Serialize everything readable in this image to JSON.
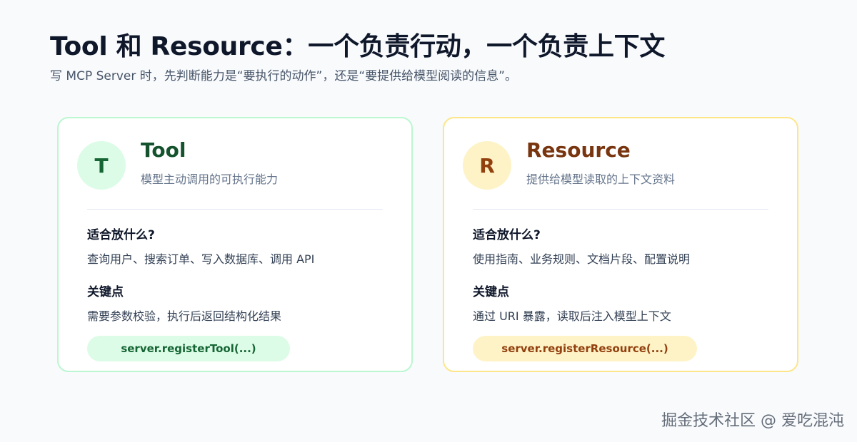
{
  "header": {
    "title": "Tool 和 Resource：一个负责行动，一个负责上下文",
    "subtitle": "写 MCP Server 时，先判断能力是“要执行的动作”，还是“要提供给模型阅读的信息”。"
  },
  "cards": [
    {
      "badge": "T",
      "title": "Tool",
      "description": "模型主动调用的可执行能力",
      "fit_heading": "适合放什么?",
      "fit_text": "查询用户、搜索订单、写入数据库、调用 API",
      "key_heading": "关键点",
      "key_text": "需要参数校验，执行后返回结构化结果",
      "code": "server.registerTool(...)",
      "colors": {
        "border": "#bbf7d0",
        "accent": "#166534",
        "badge_bg": "#dcfce7"
      }
    },
    {
      "badge": "R",
      "title": "Resource",
      "description": "提供给模型读取的上下文资料",
      "fit_heading": "适合放什么?",
      "fit_text": "使用指南、业务规则、文档片段、配置说明",
      "key_heading": "关键点",
      "key_text": "通过 URI 暴露，读取后注入模型上下文",
      "code": "server.registerResource(...)",
      "colors": {
        "border": "#fde68a",
        "accent": "#92400e",
        "badge_bg": "#fef3c7"
      }
    }
  ],
  "watermark": "掘金技术社区 @ 爱吃混沌"
}
